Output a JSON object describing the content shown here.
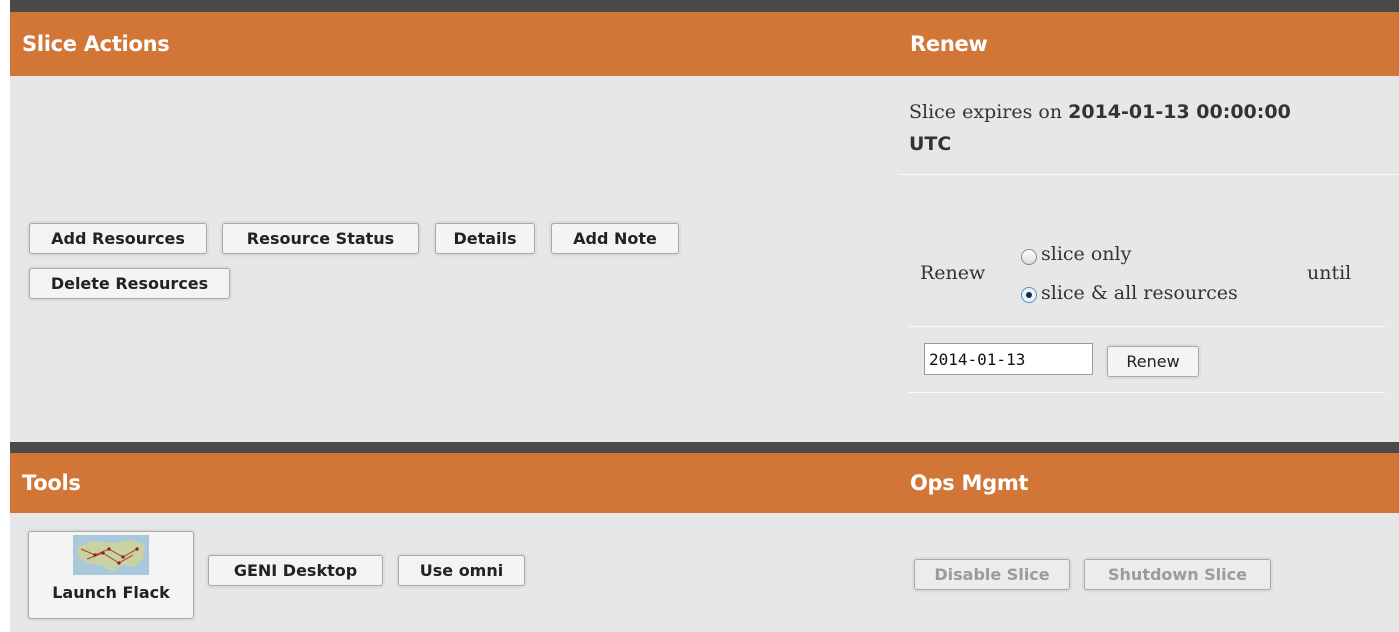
{
  "slice_actions": {
    "title": "Slice Actions",
    "buttons": {
      "add_resources": "Add Resources",
      "resource_status": "Resource Status",
      "details": "Details",
      "add_note": "Add Note",
      "delete_resources": "Delete Resources"
    }
  },
  "renew": {
    "title": "Renew",
    "expires_prefix": "Slice expires on",
    "expires_date": "2014-01-13 00:00:00",
    "expires_tz": "UTC",
    "renew_label": "Renew",
    "option_slice_only": "slice only",
    "option_all": "slice & all resources",
    "selected_option": "slice & all resources",
    "until_label": "until",
    "date_value": "2014-01-13",
    "renew_button": "Renew"
  },
  "tools": {
    "title": "Tools",
    "launch_flack": "Launch Flack",
    "geni_desktop": "GENI Desktop",
    "use_omni": "Use omni"
  },
  "ops_mgmt": {
    "title": "Ops Mgmt",
    "disable_slice": "Disable Slice",
    "shutdown_slice": "Shutdown Slice"
  },
  "colors": {
    "header_bg": "#d27638",
    "panel_bg": "#e7e7e7",
    "bar": "#4a4a4a"
  }
}
